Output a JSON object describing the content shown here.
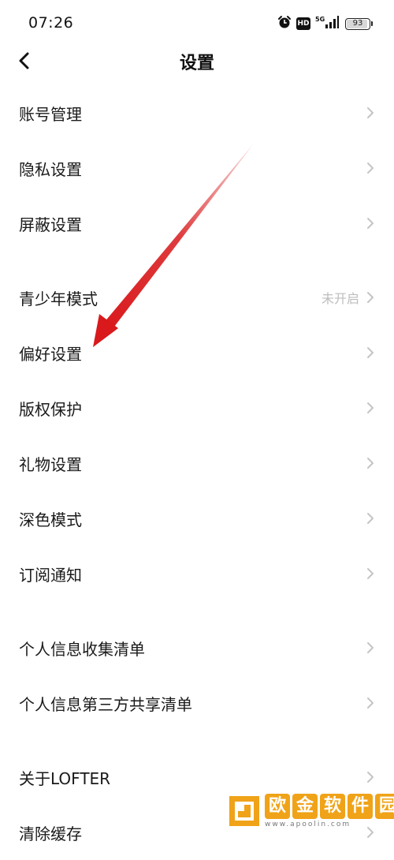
{
  "status_bar": {
    "time": "07:26",
    "network": "5G",
    "hd": "HD",
    "battery": "93",
    "battery_level": 0.93
  },
  "nav": {
    "title": "设置"
  },
  "settings": {
    "group1": [
      {
        "label": "账号管理"
      },
      {
        "label": "隐私设置"
      },
      {
        "label": "屏蔽设置"
      }
    ],
    "group2": [
      {
        "label": "青少年模式",
        "value": "未开启"
      },
      {
        "label": "偏好设置"
      },
      {
        "label": "版权保护"
      },
      {
        "label": "礼物设置"
      },
      {
        "label": "深色模式"
      },
      {
        "label": "订阅通知"
      }
    ],
    "group3": [
      {
        "label": "个人信息收集清单"
      },
      {
        "label": "个人信息第三方共享清单"
      }
    ],
    "group4": [
      {
        "label": "关于LOFTER"
      },
      {
        "label": "清除缓存"
      }
    ]
  },
  "watermark": {
    "chars": [
      "欧",
      "金",
      "软",
      "件",
      "园"
    ],
    "url": "www.apoolin.com",
    "color": "#f0a318"
  },
  "annotation": {
    "color": "#d9191c"
  }
}
